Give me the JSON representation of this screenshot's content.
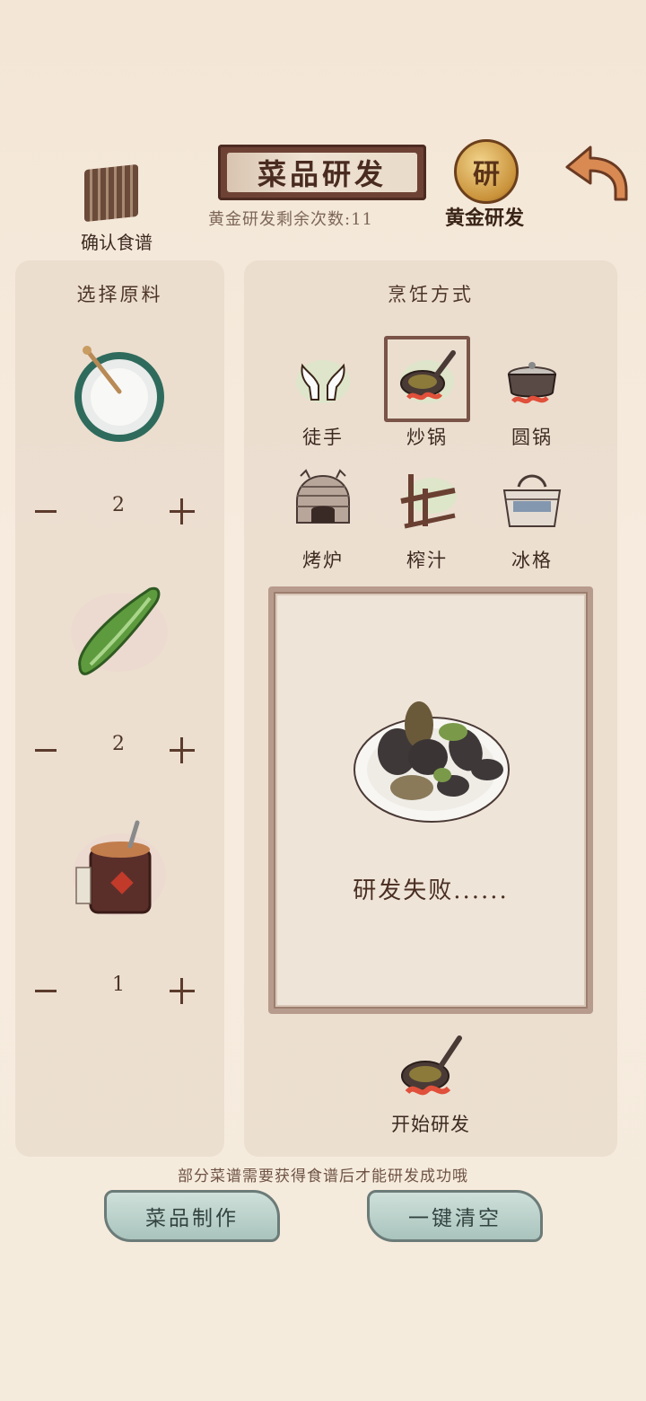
{
  "header": {
    "title": "菜品研发",
    "gold_count": "黄金研发剩余次数:11",
    "gold_button_icon_char": "研",
    "gold_button_label": "黄金研发",
    "recipe_button_label": "确认食谱"
  },
  "ingredients": {
    "title": "选择原料",
    "items": [
      {
        "icon": "flour-bowl-icon",
        "qty": "2"
      },
      {
        "icon": "cucumber-icon",
        "qty": "2"
      },
      {
        "icon": "spice-jar-icon",
        "qty": "1"
      }
    ]
  },
  "cooking": {
    "title": "烹饪方式",
    "methods": [
      {
        "label": "徒手",
        "icon": "hands-icon"
      },
      {
        "label": "炒锅",
        "icon": "wok-icon",
        "selected": true
      },
      {
        "label": "圆锅",
        "icon": "round-pot-icon"
      },
      {
        "label": "烤炉",
        "icon": "oven-icon"
      },
      {
        "label": "榨汁",
        "icon": "juicer-icon"
      },
      {
        "label": "冰格",
        "icon": "ice-box-icon"
      }
    ]
  },
  "result": {
    "text": "研发失败......"
  },
  "start": {
    "label": "开始研发"
  },
  "hint": "部分菜谱需要获得食谱后才能研发成功哦",
  "buttons": {
    "make": "菜品制作",
    "clear": "一键清空"
  }
}
